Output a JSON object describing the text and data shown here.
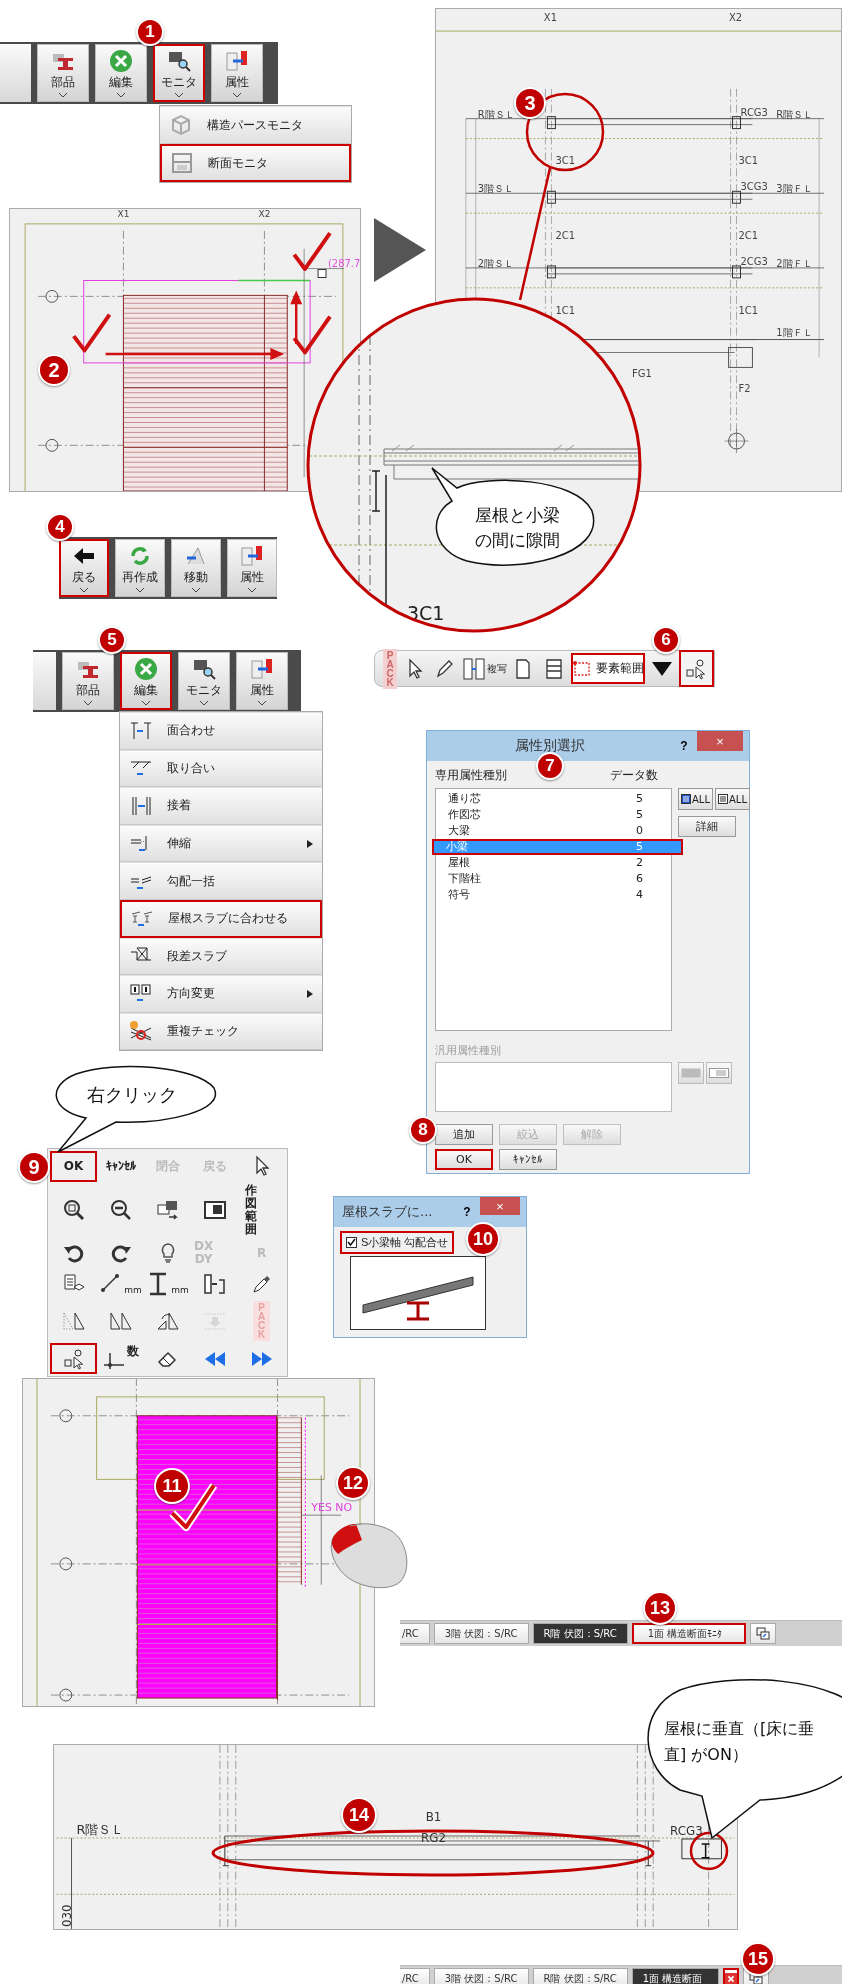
{
  "monitor_toolbar": {
    "step": "1",
    "buttons": [
      {
        "kind": "parts",
        "label": "部品",
        "highlighted": false
      },
      {
        "kind": "edit",
        "label": "編集",
        "highlighted": false
      },
      {
        "kind": "monitor",
        "label": "モニタ",
        "highlighted": true
      },
      {
        "kind": "attribute",
        "label": "属性",
        "highlighted": false
      }
    ]
  },
  "monitor_menu": {
    "items": [
      {
        "kind": "perspective",
        "label": "構造パースモニタ",
        "highlighted": false
      },
      {
        "kind": "section",
        "label": "断面モニタ",
        "highlighted": true
      }
    ]
  },
  "plan_view_1": {
    "step": "2",
    "axis_labels": [
      "X1",
      "X2"
    ],
    "dimension": "(287.7"
  },
  "section_view": {
    "step": "3",
    "axis_labels": [
      "X1",
      "X2"
    ],
    "levels_left": [
      "R階ＳＬ",
      "3階ＳＬ",
      "2階ＳＬ"
    ],
    "levels_right": [
      "R階ＳＬ",
      "3階ＦＬ",
      "2階ＦＬ",
      "1階ＦＬ"
    ],
    "girders": [
      "RCG3",
      "3CG3",
      "2CG3"
    ],
    "columns_left": [
      "3C1",
      "2C1",
      "1C1"
    ],
    "columns_right": [
      "3C1",
      "2C1",
      "1C1"
    ],
    "footing_labels": [
      "FG1",
      "F2"
    ]
  },
  "magnifier": {
    "callout": "屋根と小梁の間に隙間",
    "column_label": "3C1"
  },
  "back_toolbar": {
    "step": "4",
    "buttons": [
      {
        "kind": "back",
        "label": "戻る",
        "highlighted": true
      },
      {
        "kind": "rebuild",
        "label": "再作成",
        "highlighted": false
      },
      {
        "kind": "move",
        "label": "移動",
        "highlighted": false
      },
      {
        "kind": "attribute",
        "label": "属性",
        "highlighted": false
      }
    ]
  },
  "edit_toolbar": {
    "step": "5",
    "buttons": [
      {
        "kind": "parts",
        "label": "部品",
        "highlighted": false
      },
      {
        "kind": "edit",
        "label": "編集",
        "highlighted": true
      },
      {
        "kind": "monitor",
        "label": "モニタ",
        "highlighted": false
      },
      {
        "kind": "attribute",
        "label": "属性",
        "highlighted": false
      }
    ]
  },
  "edit_menu": {
    "items": [
      {
        "kind": "align",
        "label": "面合わせ",
        "submenu": false,
        "highlighted": false
      },
      {
        "kind": "junction",
        "label": "取り合い",
        "submenu": false,
        "highlighted": false
      },
      {
        "kind": "bond",
        "label": "接着",
        "submenu": false,
        "highlighted": false
      },
      {
        "kind": "stretch",
        "label": "伸縮",
        "submenu": true,
        "highlighted": false
      },
      {
        "kind": "slope",
        "label": "勾配一括",
        "submenu": false,
        "highlighted": false
      },
      {
        "kind": "roof",
        "label": "屋根スラブに合わせる",
        "submenu": false,
        "highlighted": true
      },
      {
        "kind": "step",
        "label": "段差スラブ",
        "submenu": false,
        "highlighted": false
      },
      {
        "kind": "direction",
        "label": "方向変更",
        "submenu": true,
        "highlighted": false
      },
      {
        "kind": "overlap",
        "label": "重複チェック",
        "submenu": false,
        "highlighted": false
      }
    ]
  },
  "select_toolbar": {
    "step": "6",
    "items": [
      {
        "kind": "pack",
        "label": "PACK",
        "highlighted": false
      },
      {
        "kind": "pointer",
        "highlighted": false
      },
      {
        "kind": "pen",
        "highlighted": false
      },
      {
        "kind": "copy",
        "label": "複写",
        "highlighted": false
      },
      {
        "kind": "doc",
        "highlighted": false
      },
      {
        "kind": "print",
        "highlighted": false
      },
      {
        "kind": "range",
        "label": "要素範囲",
        "highlighted": false
      },
      {
        "kind": "dropdown",
        "highlighted": false
      },
      {
        "kind": "select",
        "highlighted": true
      }
    ]
  },
  "attribute_dialog": {
    "title": "属性別選択",
    "help": "?",
    "close": "×",
    "step_list": "7",
    "step_ok": "8",
    "list_header": "専用属性種別",
    "count_header": "データ数",
    "rows": [
      {
        "name": "通り芯",
        "count": "5",
        "selected": false
      },
      {
        "name": "作図芯",
        "count": "5",
        "selected": false
      },
      {
        "name": "大梁",
        "count": "0",
        "selected": false
      },
      {
        "name": "小梁",
        "count": "5",
        "selected": true
      },
      {
        "name": "屋根",
        "count": "2",
        "selected": false
      },
      {
        "name": "下階柱",
        "count": "6",
        "selected": false
      },
      {
        "name": "符号",
        "count": "4",
        "selected": false
      }
    ],
    "all_buttons": [
      "ALL",
      "ALL"
    ],
    "detail_button": "詳細",
    "general_label": "汎用属性種別",
    "buttons": [
      {
        "label": "追加",
        "disabled": false,
        "highlighted": false
      },
      {
        "label": "絞込",
        "disabled": true,
        "highlighted": false
      },
      {
        "label": "解除",
        "disabled": true,
        "highlighted": false
      },
      {
        "label": "OK",
        "disabled": false,
        "highlighted": true
      },
      {
        "label": "ｷｬﾝｾﾙ",
        "disabled": false,
        "highlighted": false
      }
    ]
  },
  "right_click_callout": "右クリック",
  "palette": {
    "step": "9",
    "cells": [
      {
        "kind": "text",
        "label": "OK",
        "disabled": false,
        "highlighted": true
      },
      {
        "kind": "text",
        "label": "ｷｬﾝｾﾙ",
        "disabled": false,
        "highlighted": false
      },
      {
        "kind": "text",
        "label": "閉合",
        "disabled": true,
        "highlighted": false
      },
      {
        "kind": "text",
        "label": "戻る",
        "disabled": true,
        "highlighted": false
      },
      {
        "kind": "pointer",
        "disabled": false,
        "highlighted": false
      },
      {
        "kind": "zoomin",
        "disabled": false,
        "highlighted": false
      },
      {
        "kind": "zoomout",
        "disabled": false,
        "highlighted": false
      },
      {
        "kind": "copyview",
        "disabled": false,
        "highlighted": false
      },
      {
        "kind": "frame",
        "disabled": false,
        "highlighted": false
      },
      {
        "kind": "stack",
        "label": "作図範囲",
        "disabled": false,
        "highlighted": false
      },
      {
        "kind": "undo",
        "disabled": false,
        "highlighted": false
      },
      {
        "kind": "redo",
        "disabled": false,
        "highlighted": false
      },
      {
        "kind": "bulb",
        "disabled": false,
        "highlighted": false
      },
      {
        "kind": "stack",
        "label": "DX DY",
        "disabled": true,
        "highlighted": false
      },
      {
        "kind": "text",
        "label": "R",
        "disabled": true,
        "highlighted": false
      },
      {
        "kind": "layers",
        "disabled": false,
        "highlighted": false
      },
      {
        "kind": "measure",
        "label": "mm",
        "disabled": false,
        "highlighted": false
      },
      {
        "kind": "vmeasure",
        "label": "mm",
        "disabled": false,
        "highlighted": false
      },
      {
        "kind": "fit",
        "disabled": false,
        "highlighted": false
      },
      {
        "kind": "dropper",
        "disabled": false,
        "highlighted": false
      },
      {
        "kind": "tridot",
        "disabled": false,
        "highlighted": false
      },
      {
        "kind": "tripair",
        "disabled": false,
        "highlighted": false
      },
      {
        "kind": "trirotate",
        "disabled": false,
        "highlighted": false
      },
      {
        "kind": "down",
        "disabled": true,
        "highlighted": false
      },
      {
        "kind": "pack",
        "label": "PACK",
        "disabled": true,
        "highlighted": false
      },
      {
        "kind": "select",
        "disabled": false,
        "highlighted": true
      },
      {
        "kind": "number",
        "label": "数",
        "disabled": false,
        "highlighted": false
      },
      {
        "kind": "eraser",
        "disabled": false,
        "highlighted": false
      },
      {
        "kind": "rewind",
        "disabled": false,
        "highlighted": false
      },
      {
        "kind": "forward",
        "disabled": false,
        "highlighted": false
      }
    ]
  },
  "roof_dialog": {
    "title": "屋根スラブに...",
    "help": "?",
    "close": "×",
    "step": "10",
    "checkbox": {
      "label": "S小梁軸 勾配合せ",
      "checked": true
    }
  },
  "plan_view_2": {
    "step_select": "11",
    "step_click": "12",
    "prompt": "YES NO"
  },
  "tab_bar_1": {
    "step": "13",
    "tabs": [
      {
        "label": "/RC",
        "selected": false,
        "highlighted": false
      },
      {
        "label": "3階 伏図：S/RC",
        "selected": false,
        "highlighted": false
      },
      {
        "label": "R階 伏図：S/RC",
        "selected": true,
        "highlighted": false
      },
      {
        "label": "1面 構造断面ﾓﾆﾀ",
        "selected": false,
        "highlighted": true
      }
    ],
    "close_button": false
  },
  "section_view_2": {
    "step": "14",
    "level_label": "R階ＳＬ",
    "beam_labels": [
      "B1",
      "RG2"
    ],
    "girder_label": "RCG3",
    "dimension": "030",
    "callout": "屋根に垂直（[床に垂直] がON）"
  },
  "tab_bar_2": {
    "step": "15",
    "tabs": [
      {
        "label": "/RC",
        "selected": false,
        "highlighted": false
      },
      {
        "label": "3階 伏図：S/RC",
        "selected": false,
        "highlighted": false
      },
      {
        "label": "R階 伏図：S/RC",
        "selected": false,
        "highlighted": false
      },
      {
        "label": "1面 構造断面",
        "selected": true,
        "highlighted": false
      }
    ],
    "close_button": true
  }
}
